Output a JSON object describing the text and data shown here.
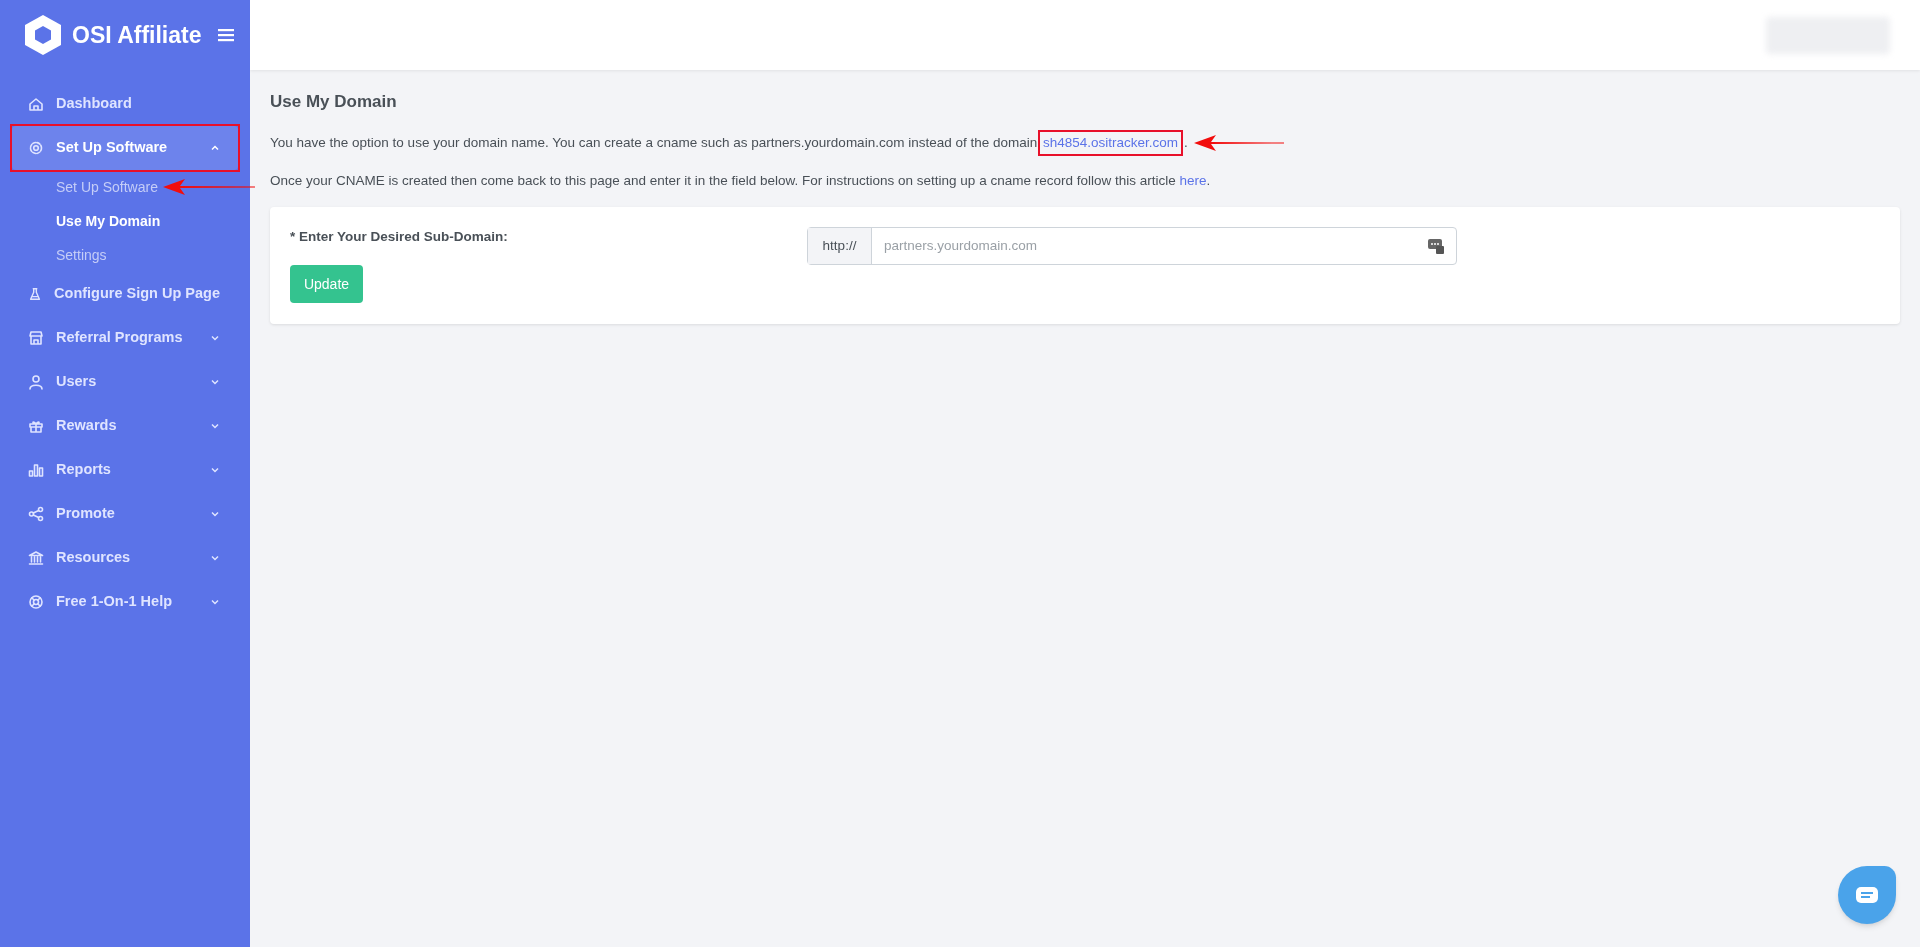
{
  "brand": {
    "name": "OSI Affiliate"
  },
  "sidebar": {
    "items": [
      {
        "label": "Dashboard",
        "kind": "link",
        "selected": false
      },
      {
        "label": "Set Up Software",
        "kind": "menu",
        "selected": true,
        "expanded": true,
        "highlighted": true,
        "children": [
          {
            "label": "Set Up Software",
            "selected": false,
            "pointed": true
          },
          {
            "label": "Use My Domain",
            "selected": true,
            "pointed": false
          },
          {
            "label": "Settings",
            "selected": false,
            "pointed": false
          }
        ]
      },
      {
        "label": "Configure Sign Up Page",
        "kind": "link",
        "selected": false
      },
      {
        "label": "Referral Programs",
        "kind": "menu",
        "selected": false,
        "expanded": false,
        "highlighted": false
      },
      {
        "label": "Users",
        "kind": "menu",
        "selected": false,
        "expanded": false,
        "highlighted": false
      },
      {
        "label": "Rewards",
        "kind": "menu",
        "selected": false,
        "expanded": false,
        "highlighted": false
      },
      {
        "label": "Reports",
        "kind": "menu",
        "selected": false,
        "expanded": false,
        "highlighted": false
      },
      {
        "label": "Promote",
        "kind": "menu",
        "selected": false,
        "expanded": false,
        "highlighted": false
      },
      {
        "label": "Resources",
        "kind": "menu",
        "selected": false,
        "expanded": false,
        "highlighted": false
      },
      {
        "label": "Free 1-On-1 Help",
        "kind": "menu",
        "selected": false,
        "expanded": false,
        "highlighted": false
      }
    ]
  },
  "page": {
    "title": "Use My Domain",
    "intro": {
      "text": "You have the option to use your domain name. You can create a cname such as partners.yourdomain.com instead of the domain",
      "link": "sh4854.ositracker.com",
      "after": ".",
      "link_highlighted": true
    },
    "instructions": {
      "text": "Once your CNAME is created then come back to this page and enter it in the field below. For instructions on setting up a cname record follow this article",
      "link": "here",
      "after": "."
    },
    "form": {
      "label": "* Enter Your Desired Sub-Domain:",
      "prefix": "http://",
      "placeholder": "partners.yourdomain.com",
      "button": "Update"
    }
  }
}
